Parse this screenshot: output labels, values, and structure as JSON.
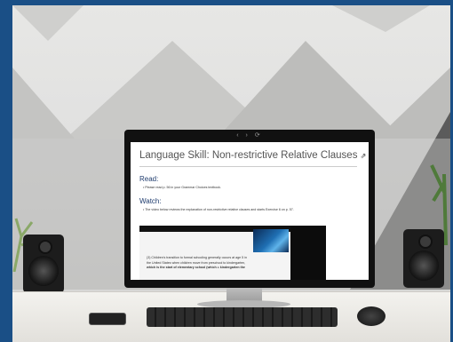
{
  "browser": {
    "toolbar_glyphs": "‹ › ⟳"
  },
  "page": {
    "title": "Language Skill: Non-restrictive Relative Clauses",
    "title_icon": "external-link-icon",
    "sections": [
      {
        "heading": "Read:",
        "bullet": "Please read p. 56 in your Grammar Choices textbook."
      },
      {
        "heading": "Watch:",
        "bullet": "The video below reviews the explanation of non-restrictive relative clauses and starts Exercise 6 on p. 57."
      }
    ],
    "video": {
      "text_lines": [
        "(3) Children's transition to formal schooling generally occurs at age 5 in",
        "the United States when children move from preschool to kindergarten,",
        "which is the start of elementary school (which = kindergarten the"
      ]
    }
  },
  "colors": {
    "frame_bg": "#1a4f86",
    "heading_blue": "#1f3c6e"
  }
}
